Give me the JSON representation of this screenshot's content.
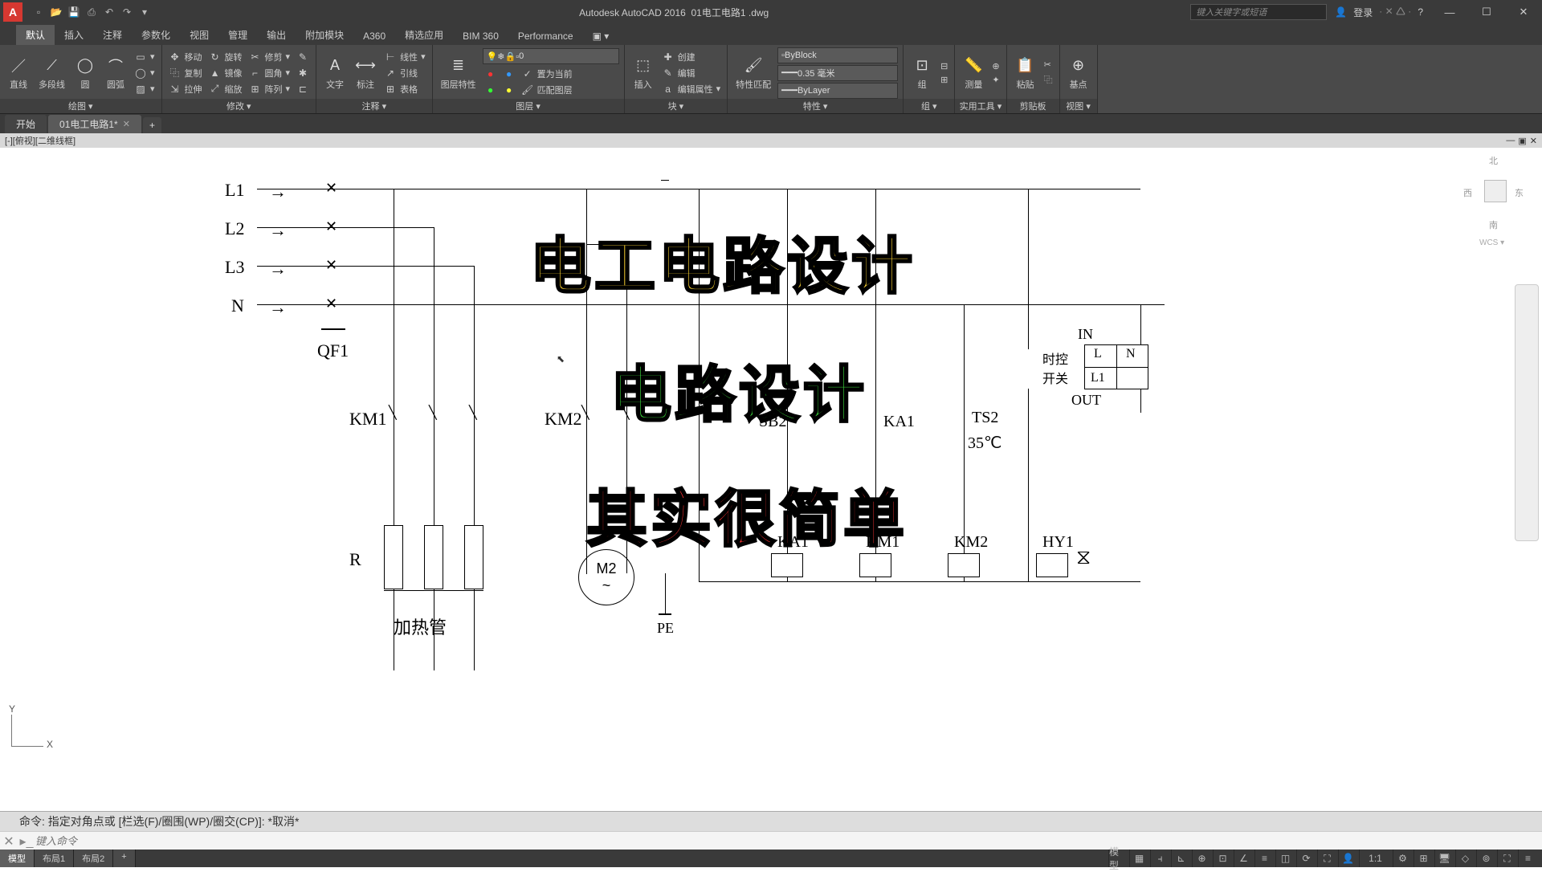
{
  "title": {
    "app": "Autodesk AutoCAD 2016",
    "file": "01电工电路1 .dwg"
  },
  "search_placeholder": "键入关键字或短语",
  "login": "登录",
  "tabs": [
    "默认",
    "插入",
    "注释",
    "参数化",
    "视图",
    "管理",
    "输出",
    "附加模块",
    "A360",
    "精选应用",
    "BIM 360",
    "Performance"
  ],
  "ribbon": {
    "draw": {
      "label": "绘图 ▾",
      "line": "直线",
      "polyline": "多段线",
      "circle": "圆",
      "arc": "圆弧"
    },
    "modify": {
      "label": "修改 ▾",
      "move": "移动",
      "rotate": "旋转",
      "trim": "修剪",
      "copy": "复制",
      "mirror": "镜像",
      "fillet": "圆角",
      "stretch": "拉伸",
      "scale": "缩放",
      "array": "阵列"
    },
    "annot": {
      "label": "注释 ▾",
      "text": "文字",
      "dim": "标注",
      "linear": "线性",
      "leader": "引线",
      "table": "表格"
    },
    "layer": {
      "label": "图层 ▾",
      "props": "图层特性",
      "cur": "0",
      "setcur": "置为当前",
      "match": "匹配图层"
    },
    "block": {
      "label": "块 ▾",
      "insert": "插入",
      "create": "创建",
      "edit": "编辑",
      "attr": "编辑属性"
    },
    "props": {
      "label": "特性 ▾",
      "color": "ByBlock",
      "lw": "0.35 毫米",
      "lt": "ByLayer",
      "match": "特性匹配"
    },
    "group": {
      "label": "组 ▾",
      "group": "组"
    },
    "util": {
      "label": "实用工具 ▾",
      "measure": "测量"
    },
    "clip": {
      "label": "剪贴板",
      "paste": "粘贴"
    },
    "view": {
      "label": "视图 ▾",
      "base": "基点"
    }
  },
  "filetabs": {
    "start": "开始",
    "f1": "01电工电路1*"
  },
  "vp_label": "[-][俯视][二维线框]",
  "overlay": {
    "l1": "电工电路设计",
    "l2": "电路设计",
    "l3": "其实很简单"
  },
  "circuit": {
    "L1": "L1",
    "L2": "L2",
    "L3": "L3",
    "N": "N",
    "QF1": "QF1",
    "KM1": "KM1",
    "KM2": "KM2",
    "R": "R",
    "heater": "加热管",
    "M2": "M2",
    "PE": "PE",
    "SB2": "SB2",
    "KA1": "KA1",
    "TS2": "TS2",
    "t35": "35℃",
    "KA1b": "KA1",
    "KM1b": "KM1",
    "KM2b": "KM2",
    "HY1": "HY1",
    "IN": "IN",
    "OUT": "OUT",
    "L": "L",
    "Nt": "N",
    "L1t": "L1",
    "timer": "时控\n开关"
  },
  "viewcube": {
    "n": "北",
    "s": "南",
    "e": "东",
    "w": "西",
    "wcs": "WCS ▾"
  },
  "cmd": {
    "history": "命令: 指定对角点或 [栏选(F)/圈围(WP)/圈交(CP)]: *取消*",
    "placeholder": "键入命令"
  },
  "layouts": {
    "model": "模型",
    "l1": "布局1",
    "l2": "布局2"
  },
  "status": {
    "model": "模型",
    "scale": "1:1"
  }
}
